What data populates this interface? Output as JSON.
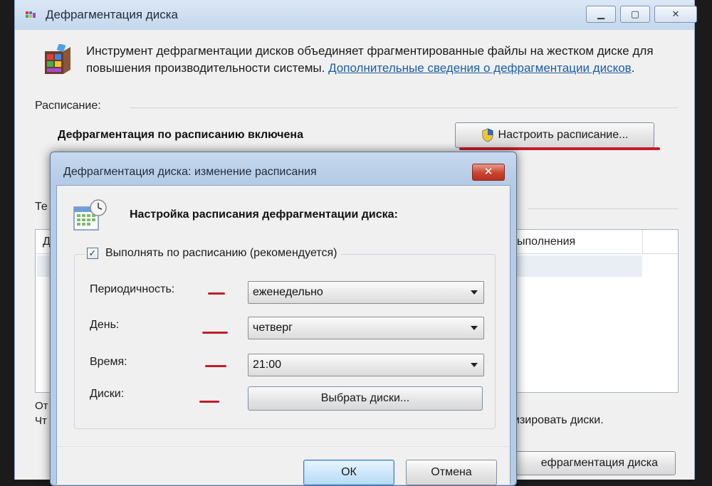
{
  "main_window": {
    "title": "Дефрагментация диска",
    "controls": {
      "minimize": "▁",
      "maximize": "▢",
      "close": "✕"
    },
    "description": "Инструмент дефрагментации дисков объединяет фрагментированные файлы на жестком диске для повышения производительности системы.",
    "more_info_link": "Дополнительные сведения о дефрагментации дисков",
    "link_suffix": ".",
    "schedule_section_label": "Расписание:",
    "schedule_status": "Дефрагментация по расписанию включена",
    "schedule_next_partial": "",
    "configure_schedule_button": "Настроить расписание...",
    "current_status_label": "Те",
    "volumes_list": {
      "col_disk": "Д",
      "col_last_run": "ыполнения"
    },
    "bottom_text_1": "От",
    "bottom_text_2": "Чт",
    "bottom_right_text": "изировать диски.",
    "defrag_now_button": "ефрагментация диска"
  },
  "dialog": {
    "title": "Дефрагментация диска: изменение расписания",
    "close_label": "✕",
    "heading": "Настройка расписания дефрагментации диска:",
    "run_on_schedule_label": "Выполнять по расписанию (рекомендуется)",
    "run_on_schedule_checked": true,
    "frequency_label": "Периодичность:",
    "frequency_value": "еженедельно",
    "day_label": "День:",
    "day_value": "четверг",
    "time_label": "Время:",
    "time_value": "21:00",
    "disks_label": "Диски:",
    "select_disks_button": "Выбрать диски...",
    "ok_button": "ОК",
    "cancel_button": "Отмена"
  },
  "colors": {
    "annotation_red": "#c21d2b",
    "link_blue": "#1c5ea5",
    "dialog_frame": "#b6cbe6"
  }
}
